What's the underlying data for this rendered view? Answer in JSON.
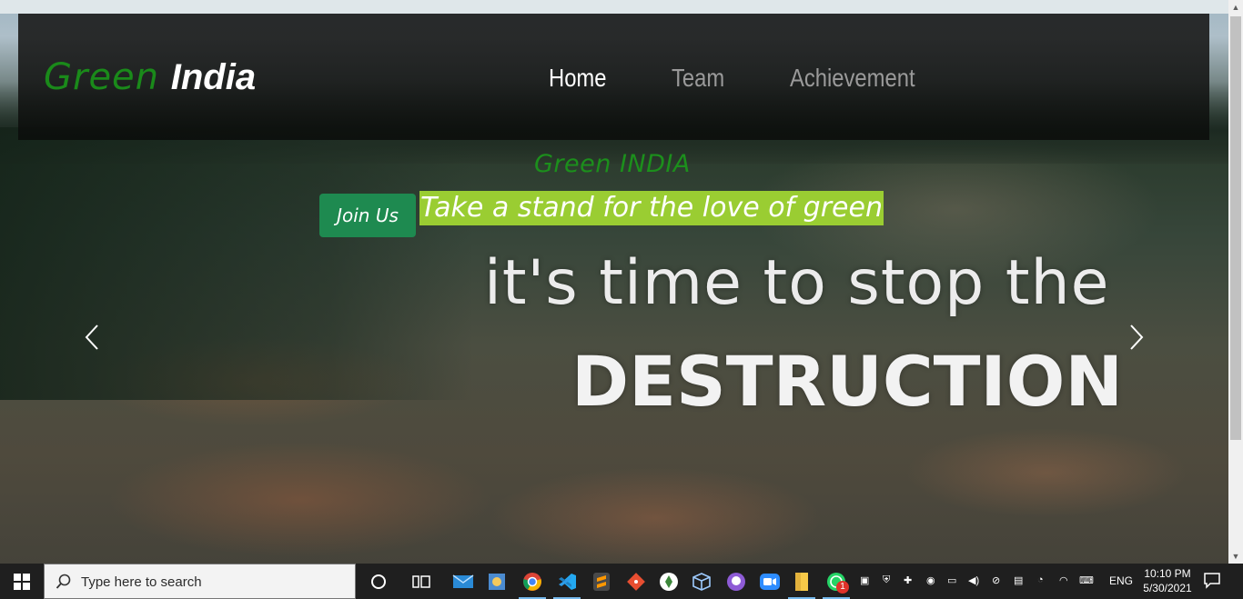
{
  "site": {
    "brand_green": "Green",
    "brand_white": "India",
    "nav": {
      "home": "Home",
      "team": "Team",
      "achievement": "Achievement"
    },
    "subtitle": "Green INDIA",
    "join_label": "Join Us",
    "tagline": "Take a stand for the love of green",
    "headline_line1": "it's time to stop the",
    "headline_line2": "DESTRUCTION",
    "carousel_prev": "prev-arrow",
    "carousel_next": "next-arrow"
  },
  "colors": {
    "brand_green": "#1a8a1a",
    "button_green": "#1e8a50",
    "tagline_bg": "#9acd32",
    "nav_inactive": "#9a9a9a"
  },
  "taskbar": {
    "search_placeholder": "Type here to search",
    "language": "ENG",
    "time": "10:10 PM",
    "date": "5/30/2021",
    "whatsapp_badge": "1",
    "icons": [
      "windows-start-icon",
      "search-icon",
      "cortana-icon",
      "task-view-icon",
      "mail-icon",
      "photo-app-icon",
      "chrome-icon",
      "vscode-icon",
      "sublime-icon",
      "git-icon",
      "node-icon",
      "virtualbox-icon",
      "github-icon",
      "zoom-icon",
      "file-explorer-icon",
      "whatsapp-icon"
    ]
  }
}
